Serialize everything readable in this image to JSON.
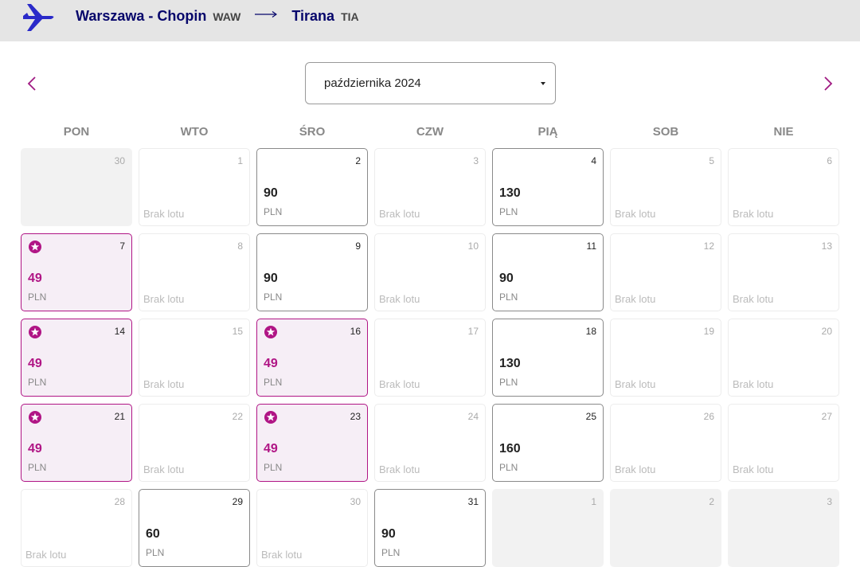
{
  "header": {
    "origin_city": "Warszawa - Chopin",
    "origin_code": "WAW",
    "destination_city": "Tirana",
    "destination_code": "TIA"
  },
  "month_select": {
    "value": "października 2024"
  },
  "weekdays": [
    "PON",
    "WTO",
    "ŚRO",
    "CZW",
    "PIĄ",
    "SOB",
    "NIE"
  ],
  "calendar": {
    "rows": [
      [
        {
          "day": "30",
          "type": "other"
        },
        {
          "day": "1",
          "type": "none",
          "note": "Brak lotu"
        },
        {
          "day": "2",
          "type": "flight",
          "price": "90",
          "currency": "PLN"
        },
        {
          "day": "3",
          "type": "none",
          "note": "Brak lotu"
        },
        {
          "day": "4",
          "type": "flight",
          "price": "130",
          "currency": "PLN"
        },
        {
          "day": "5",
          "type": "none",
          "note": "Brak lotu"
        },
        {
          "day": "6",
          "type": "none",
          "note": "Brak lotu"
        }
      ],
      [
        {
          "day": "7",
          "type": "promo",
          "price": "49",
          "currency": "PLN"
        },
        {
          "day": "8",
          "type": "none",
          "note": "Brak lotu"
        },
        {
          "day": "9",
          "type": "flight",
          "price": "90",
          "currency": "PLN"
        },
        {
          "day": "10",
          "type": "none",
          "note": "Brak lotu"
        },
        {
          "day": "11",
          "type": "flight",
          "price": "90",
          "currency": "PLN"
        },
        {
          "day": "12",
          "type": "none",
          "note": "Brak lotu"
        },
        {
          "day": "13",
          "type": "none",
          "note": "Brak lotu"
        }
      ],
      [
        {
          "day": "14",
          "type": "promo",
          "price": "49",
          "currency": "PLN"
        },
        {
          "day": "15",
          "type": "none",
          "note": "Brak lotu"
        },
        {
          "day": "16",
          "type": "promo",
          "price": "49",
          "currency": "PLN"
        },
        {
          "day": "17",
          "type": "none",
          "note": "Brak lotu"
        },
        {
          "day": "18",
          "type": "flight",
          "price": "130",
          "currency": "PLN"
        },
        {
          "day": "19",
          "type": "none",
          "note": "Brak lotu"
        },
        {
          "day": "20",
          "type": "none",
          "note": "Brak lotu"
        }
      ],
      [
        {
          "day": "21",
          "type": "promo",
          "price": "49",
          "currency": "PLN"
        },
        {
          "day": "22",
          "type": "none",
          "note": "Brak lotu"
        },
        {
          "day": "23",
          "type": "promo",
          "price": "49",
          "currency": "PLN"
        },
        {
          "day": "24",
          "type": "none",
          "note": "Brak lotu"
        },
        {
          "day": "25",
          "type": "flight",
          "price": "160",
          "currency": "PLN"
        },
        {
          "day": "26",
          "type": "none",
          "note": "Brak lotu"
        },
        {
          "day": "27",
          "type": "none",
          "note": "Brak lotu"
        }
      ],
      [
        {
          "day": "28",
          "type": "none",
          "note": "Brak lotu"
        },
        {
          "day": "29",
          "type": "flight",
          "price": "60",
          "currency": "PLN"
        },
        {
          "day": "30",
          "type": "none",
          "note": "Brak lotu"
        },
        {
          "day": "31",
          "type": "flight",
          "price": "90",
          "currency": "PLN"
        },
        {
          "day": "1",
          "type": "other"
        },
        {
          "day": "2",
          "type": "other"
        },
        {
          "day": "3",
          "type": "other"
        }
      ]
    ]
  },
  "icons": {
    "logo": "airplane-icon",
    "route_arrow": "arrow-right-icon",
    "prev": "chevron-left-icon",
    "next": "chevron-right-icon",
    "select": "caret-down-icon",
    "promo": "star-badge-icon"
  },
  "colors": {
    "brand_navy": "#06066b",
    "promo_magenta": "#b01585",
    "promo_bg": "#f6eef6",
    "header_bg": "#e5e5e5"
  }
}
